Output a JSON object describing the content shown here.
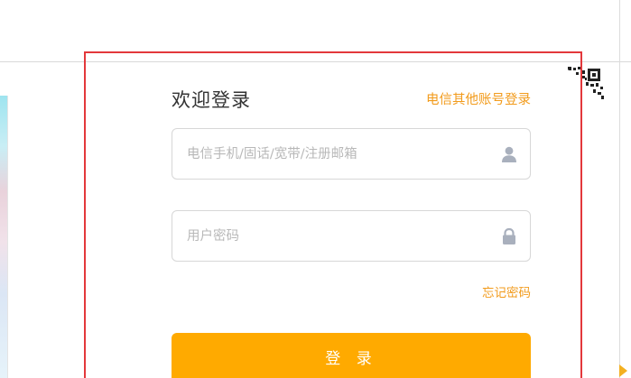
{
  "login": {
    "title": "欢迎登录",
    "other_account_link": "电信其他账号登录",
    "account_field": {
      "placeholder": "电信手机/固话/宽带/注册邮箱",
      "value": "",
      "icon": "user-icon"
    },
    "password_field": {
      "placeholder": "用户密码",
      "value": "",
      "icon": "lock-icon"
    },
    "forgot_password_link": "忘记密码",
    "submit_label": "登 录"
  },
  "decor": {
    "qr_icon": "qr-code-icon"
  },
  "colors": {
    "accent": "#ffaa00",
    "link": "#f29b1c",
    "highlight_frame": "#e3383b",
    "placeholder": "#b8b8b8",
    "icon": "#a9b0bd"
  }
}
